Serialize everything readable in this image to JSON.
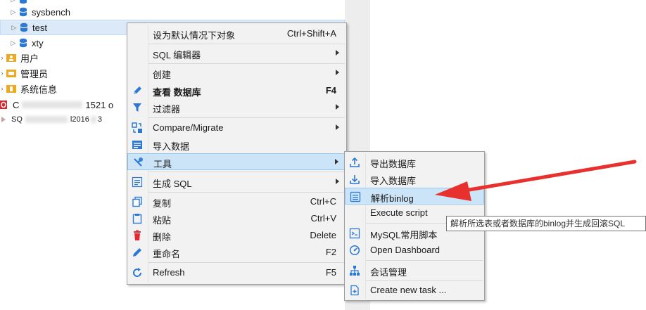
{
  "tree": {
    "items": [
      {
        "label": "sysbench"
      },
      {
        "label": "test"
      },
      {
        "label": "xty"
      },
      {
        "label": "用户"
      },
      {
        "label": "管理员"
      },
      {
        "label": "系统信息"
      }
    ],
    "conn1_prefix": "C",
    "conn1_suffix": "1521 o",
    "conn2_prefix": "SQ",
    "conn2_suffix": "l2016",
    "conn2_tail": "3"
  },
  "context_menu": {
    "set_default": "设为默认情况下对象",
    "set_default_shortcut": "Ctrl+Shift+A",
    "sql_editor": "SQL 编辑器",
    "create": "创建",
    "view_db": "查看 数据库",
    "view_db_shortcut": "F4",
    "filter": "过滤器",
    "compare": "Compare/Migrate",
    "import_data": "导入数据",
    "tools": "工具",
    "gen_sql": "生成 SQL",
    "copy": "复制",
    "copy_shortcut": "Ctrl+C",
    "paste": "粘贴",
    "paste_shortcut": "Ctrl+V",
    "delete": "删除",
    "delete_shortcut": "Delete",
    "rename": "重命名",
    "rename_shortcut": "F2",
    "refresh": "Refresh",
    "refresh_shortcut": "F5"
  },
  "tools_submenu": {
    "export_db": "导出数据库",
    "import_db": "导入数据库",
    "parse_binlog": "解析binlog",
    "execute_script": "Execute script",
    "mysql_scripts": "MySQL常用脚本",
    "open_dashboard": "Open Dashboard",
    "session_mgmt": "会话管理",
    "create_task": "Create new task ..."
  },
  "tooltip": "解析所选表或者数据库的binlog并生成回滚SQL",
  "colors": {
    "accent_blue": "#2b79d4",
    "highlight": "#cce4f7",
    "arrow_red": "#e8302f"
  }
}
